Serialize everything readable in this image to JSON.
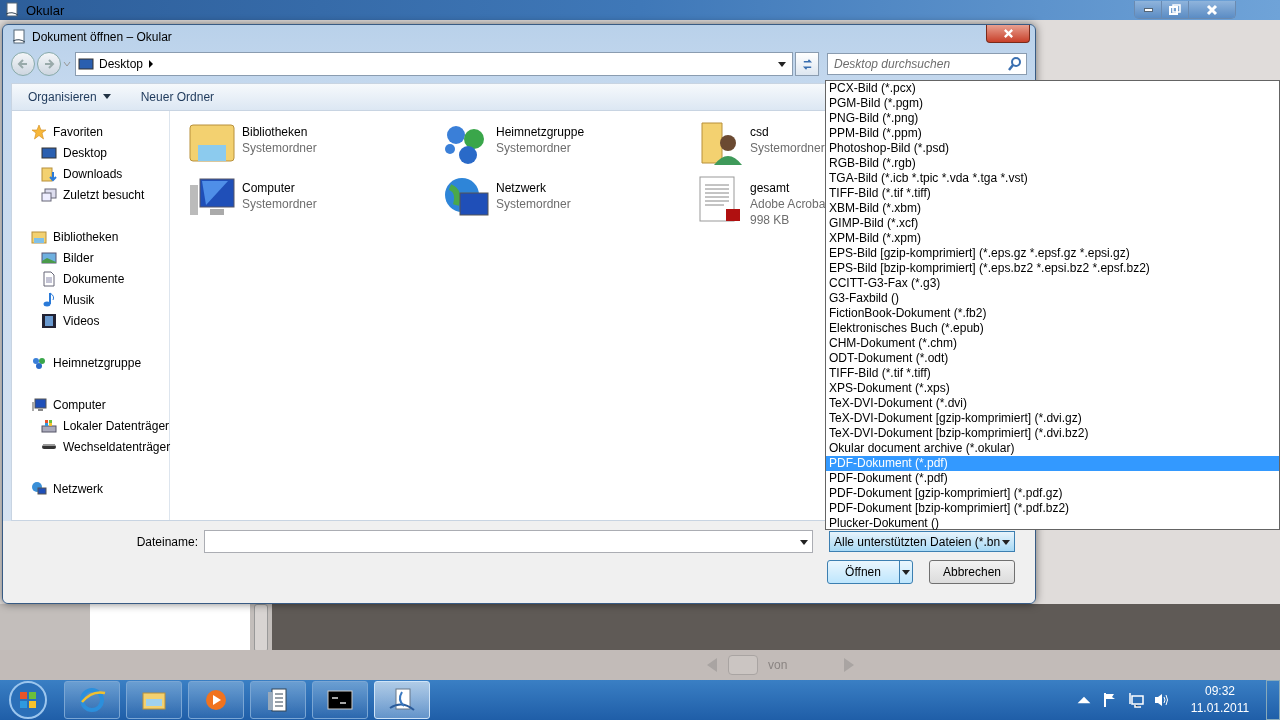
{
  "app_window": {
    "title": "Okular",
    "page_label": "von"
  },
  "dialog": {
    "title": "Dokument öffnen – Okular",
    "location": "Desktop",
    "search_placeholder": "Desktop durchsuchen",
    "toolbar": {
      "organize": "Organisieren",
      "new_folder": "Neuer Ordner"
    },
    "nav_pane": [
      {
        "label": "Favoriten",
        "kind": "star",
        "children": [
          {
            "label": "Desktop",
            "kind": "desktop"
          },
          {
            "label": "Downloads",
            "kind": "downloads"
          },
          {
            "label": "Zuletzt besucht",
            "kind": "recent"
          }
        ]
      },
      {
        "label": "Bibliotheken",
        "kind": "library",
        "children": [
          {
            "label": "Bilder",
            "kind": "pictures"
          },
          {
            "label": "Dokumente",
            "kind": "documents"
          },
          {
            "label": "Musik",
            "kind": "music"
          },
          {
            "label": "Videos",
            "kind": "videos"
          }
        ]
      },
      {
        "label": "Heimnetzgruppe",
        "kind": "homegroup"
      },
      {
        "label": "Computer",
        "kind": "computer",
        "children": [
          {
            "label": "Lokaler Datenträger",
            "kind": "disk"
          },
          {
            "label": "Wechseldatenträger",
            "kind": "removable"
          }
        ]
      },
      {
        "label": "Netzwerk",
        "kind": "network"
      }
    ],
    "items": [
      {
        "name": "Bibliotheken",
        "details": [
          "Systemordner"
        ],
        "kind": "library"
      },
      {
        "name": "Heimnetzgruppe",
        "details": [
          "Systemordner"
        ],
        "kind": "homegroup"
      },
      {
        "name": "csd",
        "details": [
          "Systemordner"
        ],
        "kind": "user"
      },
      {
        "name": "Computer",
        "details": [
          "Systemordner"
        ],
        "kind": "computer"
      },
      {
        "name": "Netzwerk",
        "details": [
          "Systemordner"
        ],
        "kind": "network"
      },
      {
        "name": "gesamt",
        "details": [
          "Adobe Acroba",
          "998 KB"
        ],
        "kind": "pdf"
      }
    ],
    "file_name_label": "Dateiname:",
    "file_type": "Alle unterstützten Dateien (*.bn",
    "buttons": {
      "open": "Öffnen",
      "cancel": "Abbrechen"
    },
    "file_type_list": [
      {
        "label": "PCX-Bild (*.pcx)",
        "selected": false
      },
      {
        "label": "PGM-Bild (*.pgm)",
        "selected": false
      },
      {
        "label": "PNG-Bild (*.png)",
        "selected": false
      },
      {
        "label": "PPM-Bild (*.ppm)",
        "selected": false
      },
      {
        "label": "Photoshop-Bild (*.psd)",
        "selected": false
      },
      {
        "label": "RGB-Bild (*.rgb)",
        "selected": false
      },
      {
        "label": "TGA-Bild (*.icb *.tpic *.vda *.tga *.vst)",
        "selected": false
      },
      {
        "label": "TIFF-Bild (*.tif *.tiff)",
        "selected": false
      },
      {
        "label": "XBM-Bild (*.xbm)",
        "selected": false
      },
      {
        "label": "GIMP-Bild (*.xcf)",
        "selected": false
      },
      {
        "label": "XPM-Bild (*.xpm)",
        "selected": false
      },
      {
        "label": "EPS-Bild [gzip-komprimiert] (*.eps.gz *.epsf.gz *.epsi.gz)",
        "selected": false
      },
      {
        "label": "EPS-Bild [bzip-komprimiert] (*.eps.bz2 *.epsi.bz2 *.epsf.bz2)",
        "selected": false
      },
      {
        "label": "CCITT-G3-Fax (*.g3)",
        "selected": false
      },
      {
        "label": "G3-Faxbild ()",
        "selected": false
      },
      {
        "label": "FictionBook-Dokument (*.fb2)",
        "selected": false
      },
      {
        "label": "Elektronisches Buch (*.epub)",
        "selected": false
      },
      {
        "label": "CHM-Dokument (*.chm)",
        "selected": false
      },
      {
        "label": "ODT-Dokument (*.odt)",
        "selected": false
      },
      {
        "label": "TIFF-Bild (*.tif *.tiff)",
        "selected": false
      },
      {
        "label": "XPS-Dokument (*.xps)",
        "selected": false
      },
      {
        "label": "TeX-DVI-Dokument (*.dvi)",
        "selected": false
      },
      {
        "label": "TeX-DVI-Dokument [gzip-komprimiert] (*.dvi.gz)",
        "selected": false
      },
      {
        "label": "TeX-DVI-Dokument [bzip-komprimiert] (*.dvi.bz2)",
        "selected": false
      },
      {
        "label": "Okular document archive (*.okular)",
        "selected": false
      },
      {
        "label": "PDF-Dokument (*.pdf)",
        "selected": true
      },
      {
        "label": "PDF-Dokument (*.pdf)",
        "selected": false
      },
      {
        "label": "PDF-Dokument [gzip-komprimiert] (*.pdf.gz)",
        "selected": false
      },
      {
        "label": "PDF-Dokument [bzip-komprimiert] (*.pdf.bz2)",
        "selected": false
      },
      {
        "label": "Plucker-Dokument ()",
        "selected": false
      }
    ]
  },
  "taskbar": {
    "apps": [
      {
        "kind": "browser",
        "active": false
      },
      {
        "kind": "explorer",
        "active": false
      },
      {
        "kind": "media",
        "active": false
      },
      {
        "kind": "document",
        "active": false
      },
      {
        "kind": "terminal",
        "active": false
      },
      {
        "kind": "okular",
        "active": true
      }
    ],
    "clock": {
      "time": "09:32",
      "date": "11.01.2011"
    }
  }
}
